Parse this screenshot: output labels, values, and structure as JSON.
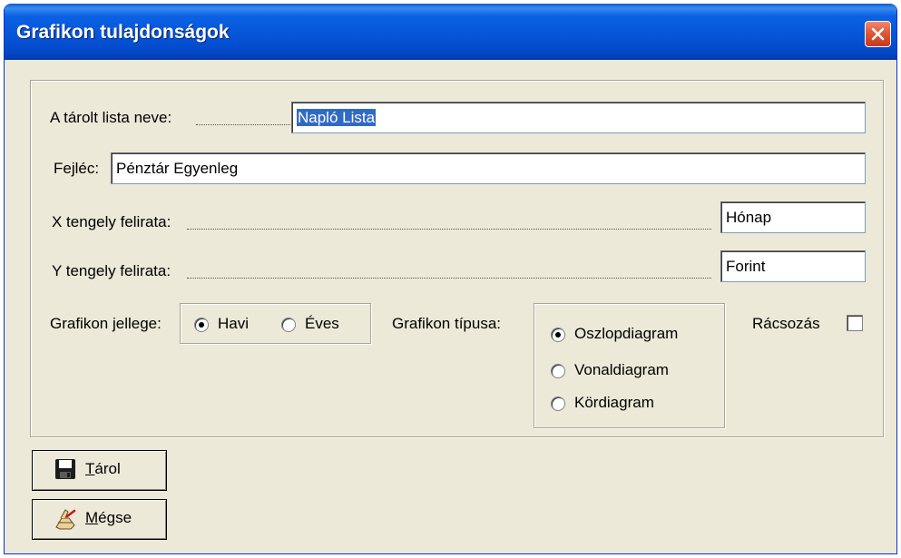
{
  "window": {
    "title": "Grafikon tulajdonságok"
  },
  "form": {
    "list_name": {
      "label": "A tárolt lista neve:",
      "value": "Napló Lista"
    },
    "header": {
      "label": "Fejléc:",
      "value": "Pénztár Egyenleg"
    },
    "x_axis": {
      "label": "X tengely felirata:",
      "value": "Hónap"
    },
    "y_axis": {
      "label": "Y tengely felirata:",
      "value": "Forint"
    },
    "chart_nature": {
      "label": "Grafikon jellege:",
      "options": [
        {
          "label": "Havi",
          "checked": true
        },
        {
          "label": "Éves",
          "checked": false
        }
      ]
    },
    "chart_type": {
      "label": "Grafikon típusa:",
      "options": [
        {
          "label": "Oszlopdiagram",
          "checked": true
        },
        {
          "label": "Vonaldiagram",
          "checked": false
        },
        {
          "label": "Kördiagram",
          "checked": false
        }
      ]
    },
    "grid": {
      "label": "Rácsozás",
      "checked": false
    }
  },
  "buttons": {
    "save": {
      "label_rest": "árol",
      "accel": "T",
      "icon": "floppy-disk-icon"
    },
    "cancel": {
      "label_rest": "égse",
      "accel": "M",
      "icon": "cancel-hand-icon"
    }
  },
  "colors": {
    "titlebar": "#0554d8",
    "close_button": "#e2573a",
    "dialog_background": "#ece9d8",
    "selection": "#316ac5"
  }
}
